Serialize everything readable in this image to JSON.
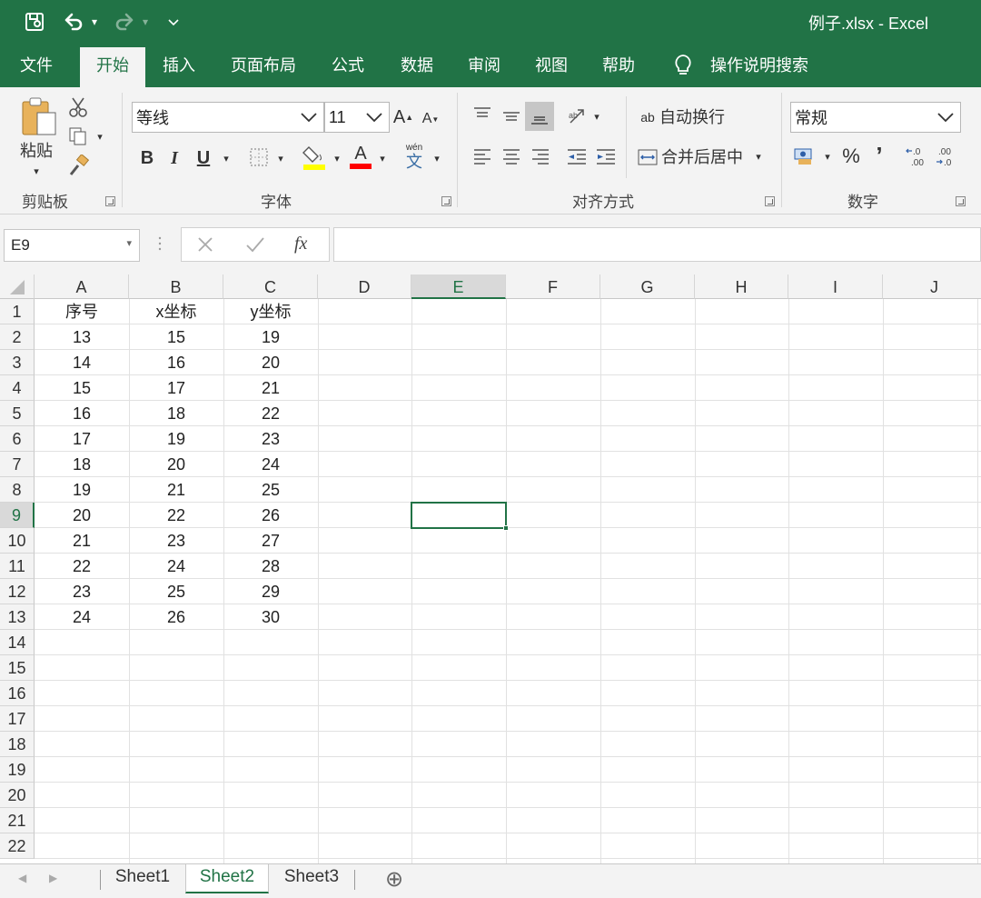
{
  "window": {
    "title": "例子.xlsx  -  Excel"
  },
  "quick_access": {
    "icons": [
      "save-icon",
      "undo-icon",
      "redo-icon",
      "customize-icon"
    ]
  },
  "menu": {
    "tabs": [
      "文件",
      "开始",
      "插入",
      "页面布局",
      "公式",
      "数据",
      "审阅",
      "视图",
      "帮助"
    ],
    "active": "开始",
    "tell_me": "操作说明搜索"
  },
  "ribbon": {
    "clipboard": {
      "paste": "粘贴",
      "label": "剪贴板"
    },
    "font": {
      "name": "等线",
      "size": "11",
      "grow": "A",
      "shrink": "A",
      "bold": "B",
      "italic": "I",
      "underline": "U",
      "font_color": "A",
      "phonetic_top": "wén",
      "phonetic_bottom": "文",
      "label": "字体"
    },
    "alignment": {
      "wrap_icon": "ab",
      "wrap": "自动换行",
      "merge": "合并后居中",
      "label": "对齐方式"
    },
    "number": {
      "format": "常规",
      "percent": "%",
      "comma": "’",
      "inc_decimal": "←.0\n.00",
      "dec_decimal": ".00\n→.0",
      "label": "数字"
    }
  },
  "formula_bar": {
    "name_box": "E9",
    "fx": "fx",
    "formula": ""
  },
  "grid": {
    "columns": [
      "A",
      "B",
      "C",
      "D",
      "E",
      "F",
      "G",
      "H",
      "I",
      "J"
    ],
    "rows": [
      "1",
      "2",
      "3",
      "4",
      "5",
      "6",
      "7",
      "8",
      "9",
      "10",
      "11",
      "12",
      "13",
      "14",
      "15",
      "16",
      "17",
      "18",
      "19",
      "20",
      "21",
      "22"
    ],
    "selected_cell": "E9",
    "cells": [
      [
        "序号",
        "x坐标",
        "y坐标"
      ],
      [
        "13",
        "15",
        "19"
      ],
      [
        "14",
        "16",
        "20"
      ],
      [
        "15",
        "17",
        "21"
      ],
      [
        "16",
        "18",
        "22"
      ],
      [
        "17",
        "19",
        "23"
      ],
      [
        "18",
        "20",
        "24"
      ],
      [
        "19",
        "21",
        "25"
      ],
      [
        "20",
        "22",
        "26"
      ],
      [
        "21",
        "23",
        "27"
      ],
      [
        "22",
        "24",
        "28"
      ],
      [
        "23",
        "25",
        "29"
      ],
      [
        "24",
        "26",
        "30"
      ]
    ]
  },
  "sheets": {
    "tabs": [
      "Sheet1",
      "Sheet2",
      "Sheet3"
    ],
    "active": "Sheet2",
    "add": "⊕"
  },
  "colors": {
    "accent": "#217346",
    "ribbon_bg": "#f3f3f3",
    "grid_line": "#e1e1e1"
  }
}
